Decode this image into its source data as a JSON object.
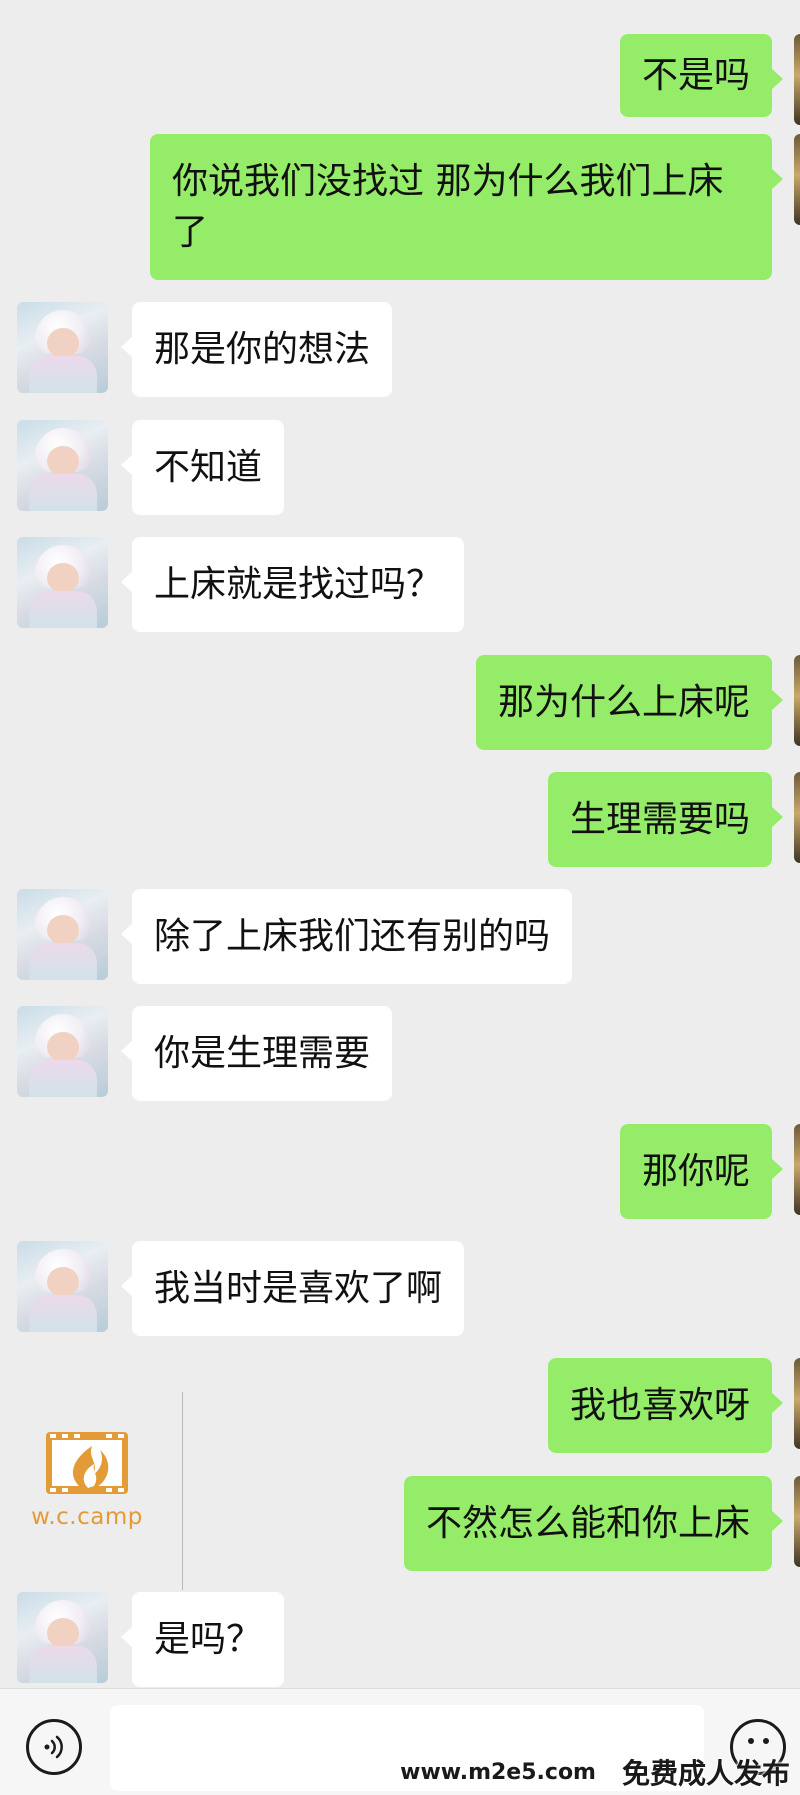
{
  "chat": {
    "messages": [
      {
        "from": "me",
        "text": "不是吗"
      },
      {
        "from": "me",
        "text": "你说我们没找过 那为什么我们上床了"
      },
      {
        "from": "other",
        "text": "那是你的想法"
      },
      {
        "from": "other",
        "text": "不知道"
      },
      {
        "from": "other",
        "text": "上床就是找过吗？"
      },
      {
        "from": "me",
        "text": "那为什么上床呢"
      },
      {
        "from": "me",
        "text": "生理需要吗"
      },
      {
        "from": "other",
        "text": "除了上床我们还有别的吗"
      },
      {
        "from": "other",
        "text": "你是生理需要"
      },
      {
        "from": "me",
        "text": "那你呢"
      },
      {
        "from": "other",
        "text": "我当时是喜欢了啊"
      },
      {
        "from": "me",
        "text": "我也喜欢呀"
      },
      {
        "from": "me",
        "text": "不然怎么能和你上床"
      },
      {
        "from": "other",
        "text": "是吗？"
      }
    ]
  },
  "watermark": {
    "logo_text": "w.c.camp",
    "site_url": "www.m2e5.com",
    "site_slogan": "免费成人发布"
  },
  "input_bar": {
    "voice_icon": "voice-icon",
    "emoji_icon": "emoji-icon",
    "input_value": ""
  },
  "colors": {
    "background": "#ededed",
    "my_bubble": "#95ec69",
    "their_bubble": "#ffffff",
    "logo_orange": "#e29b36"
  }
}
